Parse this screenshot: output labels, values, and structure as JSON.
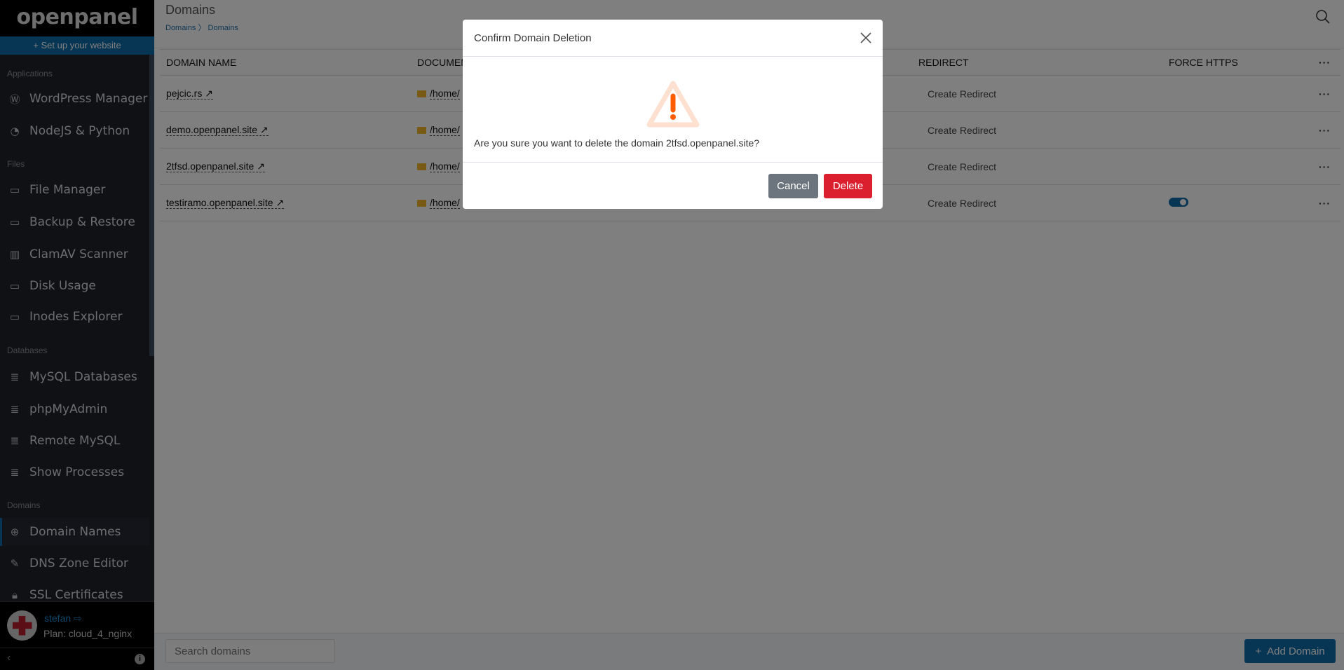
{
  "sidebar": {
    "logo": "openpanel",
    "setup_label": "+ Set up your website",
    "sections": [
      {
        "label": "Applications",
        "items": [
          {
            "label": "WordPress Manager",
            "icon": "wordpress-icon"
          },
          {
            "label": "NodeJS & Python",
            "icon": "nodejs-icon"
          }
        ]
      },
      {
        "label": "Files",
        "items": [
          {
            "label": "File Manager",
            "icon": "folder-icon"
          },
          {
            "label": "Backup & Restore",
            "icon": "folder-check-icon"
          },
          {
            "label": "ClamAV Scanner",
            "icon": "barcode-scan-icon"
          },
          {
            "label": "Disk Usage",
            "icon": "folder-plus-icon"
          },
          {
            "label": "Inodes Explorer",
            "icon": "folder-x-icon"
          }
        ]
      },
      {
        "label": "Databases",
        "items": [
          {
            "label": "MySQL Databases",
            "icon": "database-icon"
          },
          {
            "label": "phpMyAdmin",
            "icon": "database-dot-icon"
          },
          {
            "label": "Remote MySQL",
            "icon": "database-info-icon"
          },
          {
            "label": "Show Processes",
            "icon": "database-check-icon"
          }
        ]
      },
      {
        "label": "Domains",
        "items": [
          {
            "label": "Domain Names",
            "icon": "globe-icon",
            "active": true
          },
          {
            "label": "DNS Zone Editor",
            "icon": "edit-icon"
          },
          {
            "label": "SSL Certificates",
            "icon": "lock-icon"
          }
        ]
      }
    ],
    "user": {
      "name": "stefan",
      "plan": "Plan: cloud_4_nginx"
    }
  },
  "header": {
    "title": "Domains",
    "breadcrumb": [
      "Domains",
      "Domains"
    ]
  },
  "table": {
    "columns": [
      "DOMAIN NAME",
      "DOCUMENT ROOT",
      "REDIRECT",
      "FORCE HTTPS"
    ],
    "rows": [
      {
        "domain": "pejcic.rs",
        "docroot": "/home/",
        "redirect": "Create Redirect",
        "force_https": false
      },
      {
        "domain": "demo.openpanel.site",
        "docroot": "/home/",
        "redirect": "Create Redirect",
        "force_https": false
      },
      {
        "domain": "2tfsd.openpanel.site",
        "docroot": "/home/",
        "redirect": "Create Redirect",
        "force_https": false
      },
      {
        "domain": "testiramo.openpanel.site",
        "docroot": "/home/",
        "redirect": "Create Redirect",
        "force_https": true
      }
    ]
  },
  "footer": {
    "search_placeholder": "Search domains",
    "add_label": "Add Domain"
  },
  "modal": {
    "title": "Confirm Domain Deletion",
    "message": "Are you sure you want to delete the domain 2tfsd.openpanel.site?",
    "cancel_label": "Cancel",
    "delete_label": "Delete"
  },
  "colors": {
    "accent": "#0e6aa8",
    "danger": "#dc1f2e",
    "warning": "#fd5c00"
  }
}
